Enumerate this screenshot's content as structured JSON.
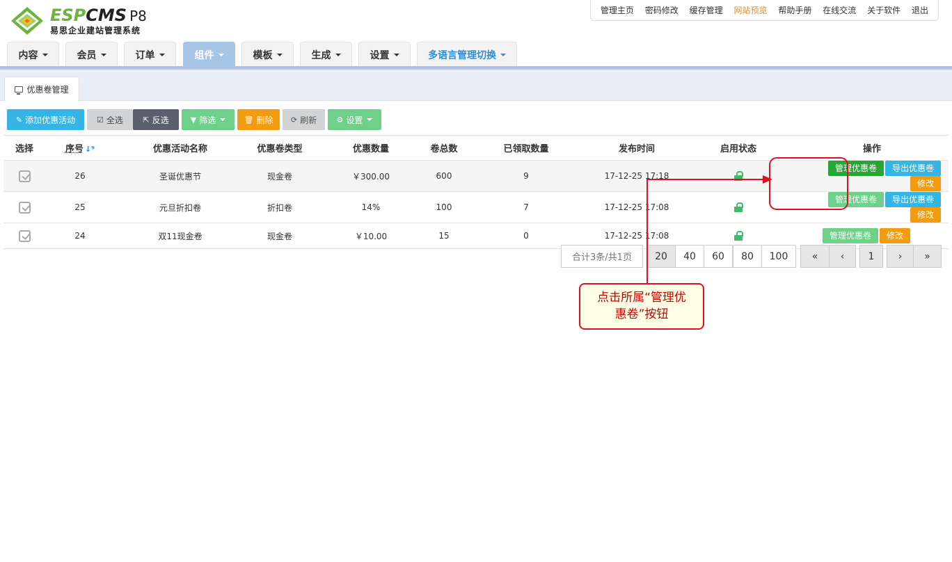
{
  "brand": {
    "name_part1": "ESP",
    "name_part2": "CMS",
    "version": "P8",
    "subtitle": "易思企业建站管理系统"
  },
  "topnav": [
    "管理主页",
    "密码修改",
    "缓存管理",
    "网站预览",
    "帮助手册",
    "在线交流",
    "关于软件",
    "退出"
  ],
  "mainnav": [
    "内容",
    "会员",
    "订单",
    "组件",
    "模板",
    "生成",
    "设置",
    "多语言管理切换"
  ],
  "subtab": "优惠卷管理",
  "toolbar": {
    "add": "添加优惠活动",
    "select_all": "全选",
    "invert": "反选",
    "filter": "筛选",
    "delete": "删除",
    "refresh": "刷新",
    "settings": "设置"
  },
  "table": {
    "headers": [
      "选择",
      "序号",
      "优惠活动名称",
      "优惠卷类型",
      "优惠数量",
      "卷总数",
      "已领取数量",
      "发布时间",
      "启用状态",
      "操作"
    ],
    "rows": [
      {
        "id": "26",
        "name": "圣诞优惠节",
        "type": "现金卷",
        "amount": "￥300.00",
        "total": "600",
        "received": "9",
        "time": "17-12-25 17:18"
      },
      {
        "id": "25",
        "name": "元旦折扣卷",
        "type": "折扣卷",
        "amount": "14%",
        "total": "100",
        "received": "7",
        "time": "17-12-25 17:08"
      },
      {
        "id": "24",
        "name": "双11现金卷",
        "type": "现金卷",
        "amount": "￥10.00",
        "total": "15",
        "received": "0",
        "time": "17-12-25 17:08"
      }
    ],
    "ops": {
      "manage": "管理优惠卷",
      "export": "导出优惠卷",
      "edit": "修改"
    }
  },
  "pager": {
    "info": "合计3条/共1页",
    "sizes": [
      "20",
      "40",
      "60",
      "80",
      "100"
    ],
    "current": "1"
  },
  "annotation": {
    "line1": "点击所属“管理优",
    "line2": "惠卷”按钮"
  },
  "colors": {
    "accent_blue": "#34b5e6",
    "green": "#27a635",
    "orange": "#f39c12",
    "annotation_red": "#e01020",
    "nav_active": "#a6c6e7"
  }
}
